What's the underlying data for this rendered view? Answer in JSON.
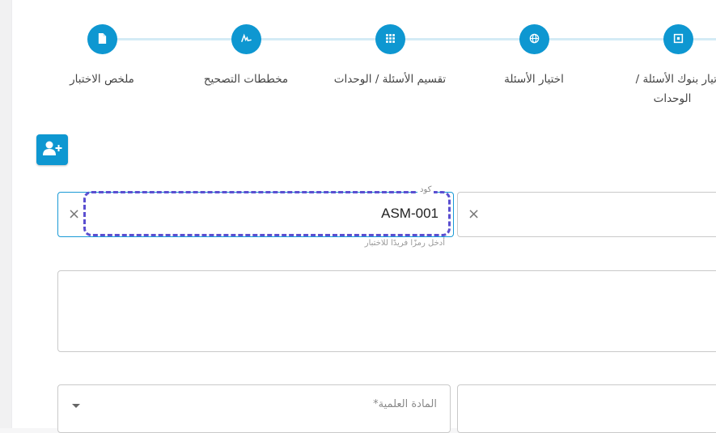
{
  "stepper": {
    "steps": [
      {
        "label": "ملخص الاختبار",
        "icon": "document-icon"
      },
      {
        "label": "مخططات التصحيح",
        "icon": "signature-icon"
      },
      {
        "label": "تقسيم الأسئلة / الوحدات",
        "icon": "grid-icon"
      },
      {
        "label": "اختيار الأسئلة",
        "icon": "globe-icon"
      },
      {
        "label_line1": "تيار بنوك الأسئلة /",
        "label_line2": "الوحدات",
        "icon": "square-icon"
      }
    ]
  },
  "toolbar": {
    "add_user_icon": "add-user-icon"
  },
  "code_field": {
    "label": "كود",
    "value": "ASM-001",
    "helper": "أدخل رمزًا فريدًا للاختبار",
    "clear_glyph": "×"
  },
  "name_field": {
    "clear_glyph": "×"
  },
  "subject_select": {
    "placeholder": "المادة العلمية*"
  },
  "colors": {
    "primary": "#0e97d1",
    "highlight": "#5b4fd0",
    "stepper_line": "#d4ebf6"
  }
}
